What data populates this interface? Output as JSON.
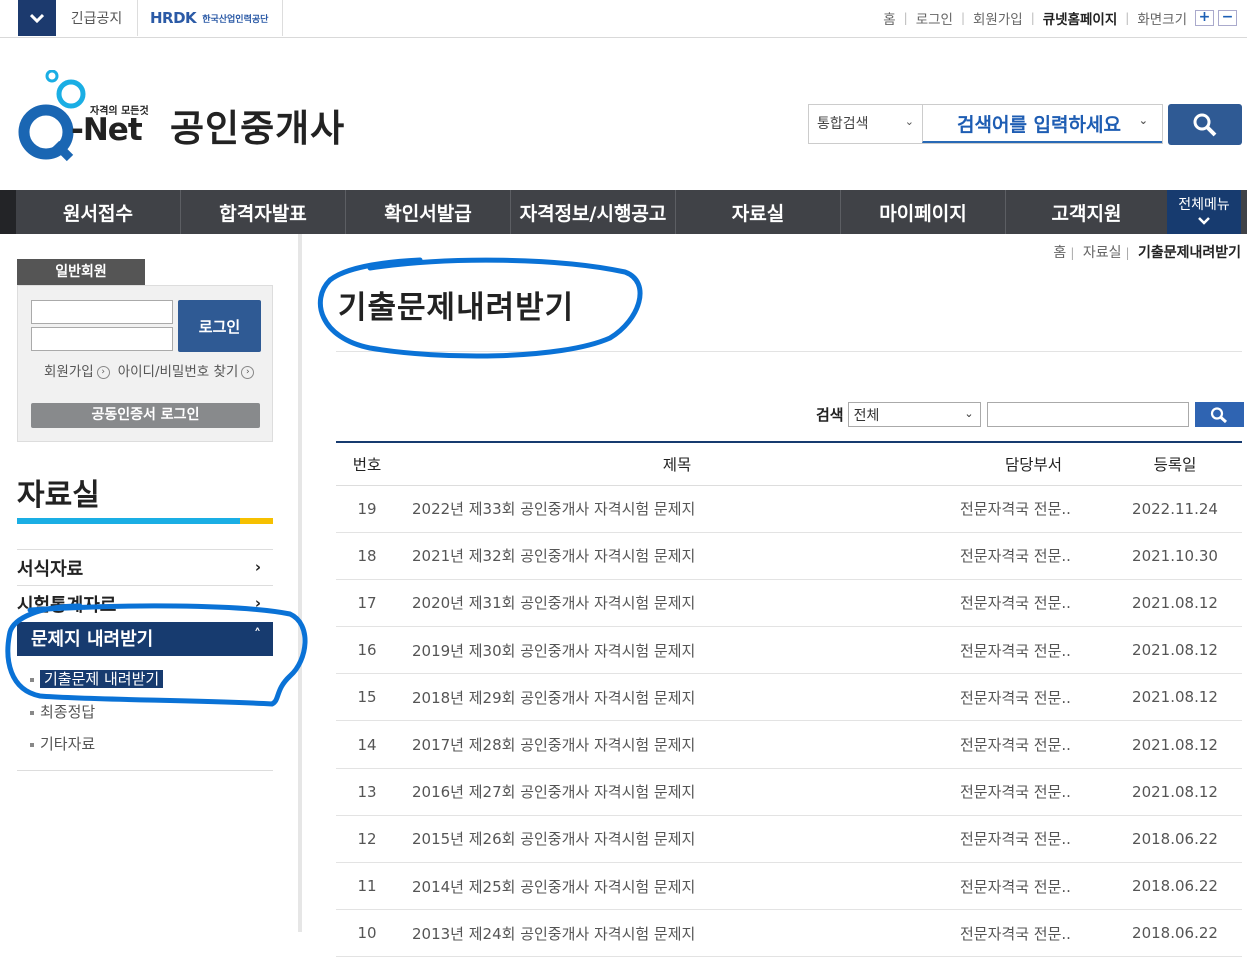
{
  "topbar": {
    "notice": "긴급공지",
    "hrdk_logo": "HRDK",
    "hrdk_name": "한국산업인력공단",
    "links": [
      "홈",
      "로그인",
      "회원가입",
      "큐넷홈페이지",
      "화면크기"
    ],
    "zoom_in": "+",
    "zoom_out": "−"
  },
  "header": {
    "logo_tagline": "자격의 모든것",
    "logo_text": "Q-Net",
    "title": "공인중개사",
    "search_scope": "통합검색",
    "search_placeholder": "검색어를 입력하세요"
  },
  "gnb": {
    "items": [
      "원서접수",
      "합격자발표",
      "확인서발급",
      "자격정보/시행공고",
      "자료실",
      "마이페이지",
      "고객지원"
    ],
    "all_menu": "전체메뉴"
  },
  "breadcrumb": {
    "home": "홈",
    "section": "자료실",
    "current": "기출문제내려받기"
  },
  "login": {
    "tab": "일반회원",
    "button": "로그인",
    "join": "회원가입",
    "find": "아이디/비밀번호 찾기",
    "cert": "공동인증서 로그인"
  },
  "side": {
    "title": "자료실",
    "items": [
      "서식자료",
      "시험통계자료"
    ],
    "active": "문제지 내려받기",
    "subs": [
      "기출문제 내려받기",
      "최종정답",
      "기타자료"
    ]
  },
  "content": {
    "title": "기출문제내려받기",
    "filter_label": "검색",
    "filter_value": "전체",
    "columns": [
      "번호",
      "제목",
      "담당부서",
      "등록일"
    ],
    "rows": [
      {
        "no": "19",
        "title": "2022년 제33회 공인중개사 자격시험 문제지",
        "dept": "전문자격국 전문..",
        "date": "2022.11.24"
      },
      {
        "no": "18",
        "title": "2021년 제32회 공인중개사 자격시험 문제지",
        "dept": "전문자격국 전문..",
        "date": "2021.10.30"
      },
      {
        "no": "17",
        "title": "2020년 제31회 공인중개사 자격시험 문제지",
        "dept": "전문자격국 전문..",
        "date": "2021.08.12"
      },
      {
        "no": "16",
        "title": "2019년 제30회 공인중개사 자격시험 문제지",
        "dept": "전문자격국 전문..",
        "date": "2021.08.12"
      },
      {
        "no": "15",
        "title": "2018년 제29회 공인중개사 자격시험 문제지",
        "dept": "전문자격국 전문..",
        "date": "2021.08.12"
      },
      {
        "no": "14",
        "title": "2017년 제28회 공인중개사 자격시험 문제지",
        "dept": "전문자격국 전문..",
        "date": "2021.08.12"
      },
      {
        "no": "13",
        "title": "2016년 제27회 공인중개사 자격시험 문제지",
        "dept": "전문자격국 전문..",
        "date": "2021.08.12"
      },
      {
        "no": "12",
        "title": "2015년 제26회 공인중개사 자격시험 문제지",
        "dept": "전문자격국 전문..",
        "date": "2018.06.22"
      },
      {
        "no": "11",
        "title": "2014년 제25회 공인중개사 자격시험 문제지",
        "dept": "전문자격국 전문..",
        "date": "2018.06.22"
      },
      {
        "no": "10",
        "title": "2013년 제24회 공인중개사 자격시험 문제지",
        "dept": "전문자격국 전문..",
        "date": "2018.06.22"
      }
    ]
  },
  "colors": {
    "navy": "#173b6f",
    "brand_blue": "#2f5a94",
    "accent_cyan": "#1aaee4",
    "accent_yellow": "#f6c000",
    "annotation": "#0a72d6"
  }
}
